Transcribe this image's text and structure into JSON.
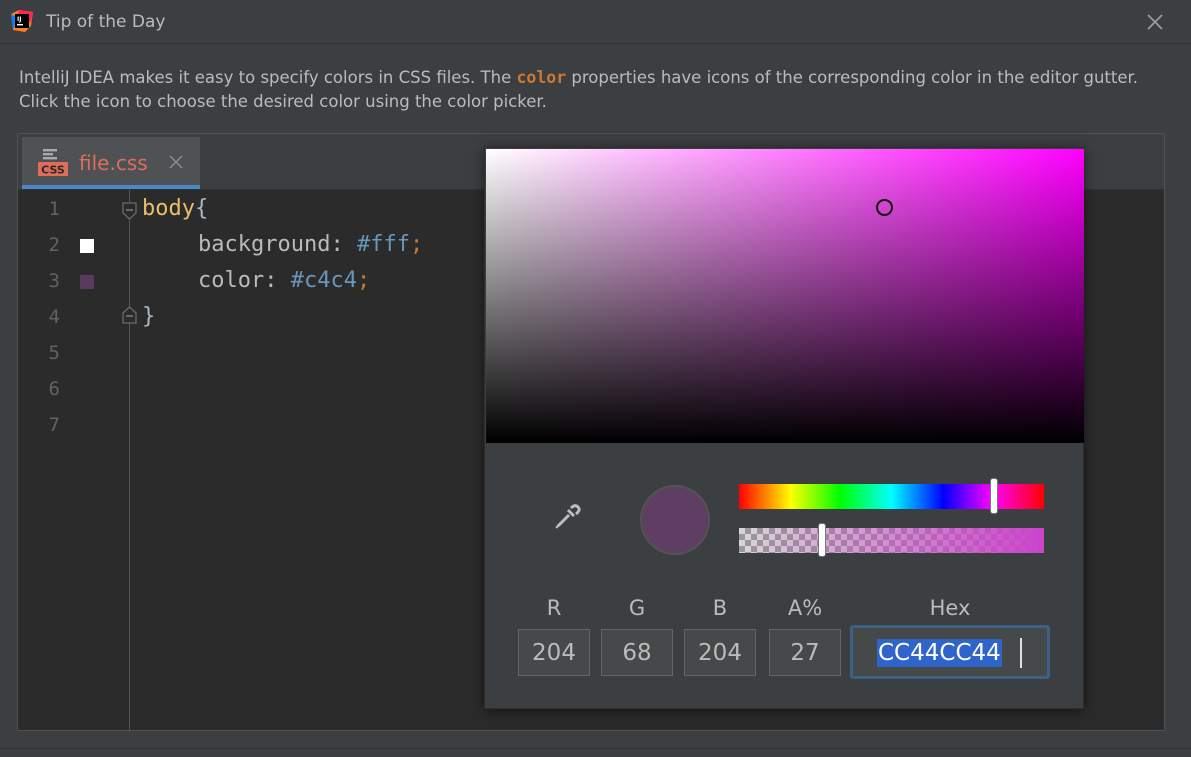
{
  "window": {
    "title": "Tip of the Day",
    "logo_icon": "intellij-idea-logo"
  },
  "tip": {
    "text_before": "IntelliJ IDEA makes it easy to specify colors in CSS files. The ",
    "keyword": "color",
    "text_after": " properties have icons of the corresponding color in the editor gutter. Click the icon to choose the desired color using the color picker."
  },
  "editor": {
    "tab_icon_label": "CSS",
    "tab_label": "file.css",
    "line_numbers": [
      "1",
      "2",
      "3",
      "4",
      "5",
      "6",
      "7"
    ],
    "code": {
      "selector": "body",
      "open_brace": "{",
      "close_brace": "}",
      "line2_prop": "background: ",
      "line2_val": "#fff",
      "line3_prop": "color: ",
      "line3_val": "#c4c4",
      "semicolon": ";"
    },
    "gutter_swatches": {
      "line2": "#ffffff",
      "line3": "#5a3a5e"
    }
  },
  "color_picker": {
    "base_hue_color": "#ff00ff",
    "preview_color": "#5f3e63",
    "hue_level_percent": 84,
    "alpha_level_percent": 27,
    "channels": [
      {
        "label": "R",
        "value": "204"
      },
      {
        "label": "G",
        "value": "68"
      },
      {
        "label": "B",
        "value": "204"
      },
      {
        "label": "A%",
        "value": "27"
      }
    ],
    "hex": {
      "label": "Hex",
      "value": "CC44CC44"
    }
  },
  "colors": {
    "accent": "#4a88c7",
    "selection": "#2f65ca",
    "tab_label": "#e06c5b",
    "keyword": "#cc7832"
  }
}
